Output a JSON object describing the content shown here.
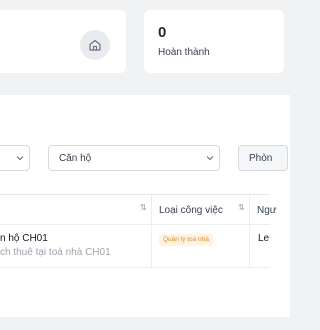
{
  "stats": {
    "completed_value": "0",
    "completed_label": "Hoàn thành"
  },
  "filters": {
    "select_apartment": "Căn hộ",
    "select_room_partial": "Phòn"
  },
  "table": {
    "headers": [
      "Loại công việc",
      "Ngư"
    ],
    "rows": [
      {
        "title": "n hộ CH01",
        "subtitle": "ch thuê tại toà nhà CH01",
        "type_tag": "Quản lý toà nhà",
        "col3": "Le"
      }
    ]
  },
  "colors": {
    "tag_bg": "#fff3e6",
    "tag_text": "#f08a1c",
    "background": "#f1f2f4"
  }
}
